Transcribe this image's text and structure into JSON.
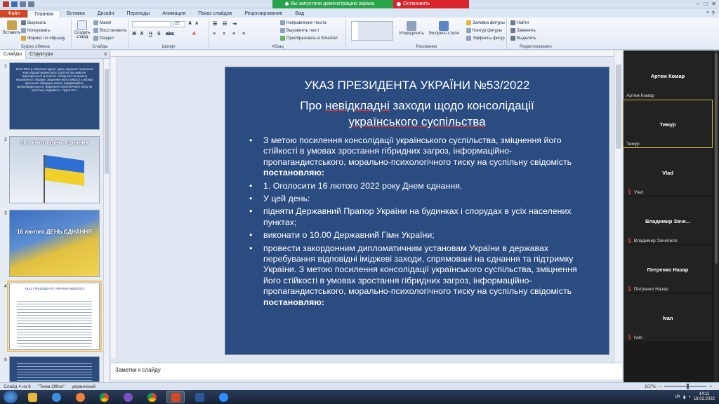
{
  "window": {
    "share_status": "Вы запустили демонстрацию экрана",
    "stop_share": "Остановить демонстрацию"
  },
  "ribbon_tabs": [
    "Файл",
    "Главная",
    "Вставка",
    "Дизайн",
    "Переходы",
    "Анимация",
    "Показ слайдов",
    "Рецензирование",
    "Вид"
  ],
  "ribbon": {
    "clipboard": {
      "paste": "Вставить",
      "cut": "Вырезать",
      "copy": "Копировать",
      "format_painter": "Формат по образцу",
      "label": "Буфер обмена"
    },
    "slides": {
      "new_slide": "Создать слайд",
      "layout": "Макет",
      "reset": "Восстановить",
      "section": "Раздел",
      "label": "Слайды"
    },
    "font": {
      "size": "22",
      "label": "Шрифт"
    },
    "paragraph": {
      "text_direction": "Направление текста",
      "align_text": "Выровнять текст",
      "smartart": "Преобразовать в SmartArt",
      "label": "Абзац"
    },
    "drawing": {
      "arrange": "Упорядочить",
      "quick_styles": "Экспресс-стили",
      "fill": "Заливка фигуры",
      "outline": "Контур фигуры",
      "effects": "Эффекты фигур",
      "label": "Рисование"
    },
    "editing": {
      "find": "Найти",
      "replace": "Заменить",
      "select": "Выделить",
      "label": "Редактирование"
    }
  },
  "left_panel": {
    "tabs": [
      "Слайды",
      "Структура"
    ],
    "close": "x",
    "thumbnails": [
      {
        "num": "1",
        "text": "18.02.2022 р. Виховна година «День єднання: посилення консолідації українського суспільства навколо територіальної цілісності, соборності та захисту незалежності України, зміцнення його стійкості в умовах зростання гібридних загроз, інформаційно-пропагандистського, морально-психологічного тиску на суспільну свідомість». Група 33-А"
      },
      {
        "num": "2",
        "text": "16 лютого День єднання"
      },
      {
        "num": "3",
        "text": "16 лютого ДЕНЬ ЄДНАННЯ"
      },
      {
        "num": "4",
        "text": "УКАЗ ПРЕЗИДЕНТА УКРАЇНИ №53/2022"
      },
      {
        "num": "5",
        "text": ""
      }
    ]
  },
  "slide": {
    "title_line1": "УКАЗ ПРЕЗИДЕНТА УКРАЇНИ №53/2022",
    "title_line2_pre": "Про ",
    "title_line2_u": "невідкладні",
    "title_line2_post": " заходи щодо консолідації",
    "title_line3": "українського суспільства",
    "bullets": [
      {
        "text": "З метою посилення консолідації українського суспільства, зміцнення його стійкості в умовах зростання гібридних загроз, інформаційно-пропагандистського, морально-психологічного тиску на суспільну свідомість ",
        "bold": "постановляю:"
      },
      {
        "text": "1. Оголосити 16 лютого 2022 року Днем єднання.",
        "bold": ""
      },
      {
        "text": "У цей день:",
        "bold": ""
      },
      {
        "text": "підняти Державний Прапор України на будинках і спорудах в усіх населених пунктах;",
        "bold": ""
      },
      {
        "text": "виконати о 10.00 Державний Гімн України;",
        "bold": ""
      },
      {
        "text": "провести закордонним дипломатичним установам України в державах перебування відповідні іміджеві заходи, спрямовані на єднання та підтримку України. З метою посилення консолідації українського суспільства, зміцнення його стійкості в умовах зростання гібридних загроз, інформаційно-пропагандистського, морально-психологічного тиску на суспільну свідомість ",
        "bold": "постановляю:"
      }
    ]
  },
  "notes_placeholder": "Заметки к слайду",
  "participants": [
    {
      "display": "Артем Комар",
      "label": "Артем Комар",
      "muted": false
    },
    {
      "display": "Тимур",
      "label": "Тимур",
      "muted": false
    },
    {
      "display": "Vlad",
      "label": "Vlad",
      "muted": true
    },
    {
      "display": "Владимир Заче...",
      "label": "Владимир Зачепило",
      "muted": true
    },
    {
      "display": "Петренко Назар",
      "label": "Петренко Назар",
      "muted": true
    },
    {
      "display": "Ivan",
      "label": "Ivan",
      "muted": true
    }
  ],
  "status_bar": {
    "slide_info": "Слайд 4 из 6",
    "theme": "\"Тема Office\"",
    "language": "украинский",
    "zoom": "107%",
    "zoom_fraction": 0.55
  },
  "taskbar": {
    "apps": [
      "explorer",
      "ie",
      "media",
      "chrome",
      "viber",
      "chrome2",
      "powerpoint",
      "word",
      "zoom"
    ],
    "time": "14:11",
    "date": "18.02.2022",
    "lang": "UK"
  },
  "colors": {
    "slide_bg": "#2a4c80",
    "file_tab": "#d24726",
    "share_green": "#2aa44b",
    "share_red": "#d9262c"
  }
}
